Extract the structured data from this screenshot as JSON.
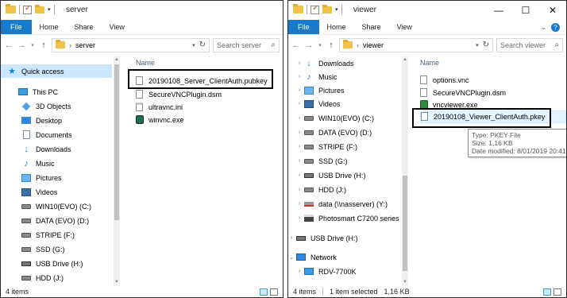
{
  "left_window": {
    "title": "server",
    "ribbon_tabs": [
      "File",
      "Home",
      "Share",
      "View"
    ],
    "address": "server",
    "search_placeholder": "Search server",
    "column_name": "Name",
    "files": [
      {
        "name": "20190108_Server_ClientAuth.pubkey",
        "icon": "file-icon"
      },
      {
        "name": "SecureVNCPlugin.dsm",
        "icon": "file-icon"
      },
      {
        "name": "ultravnc.ini",
        "icon": "ini-file-icon"
      },
      {
        "name": "winvnc.exe",
        "icon": "winvnc-exe-icon"
      }
    ],
    "nav_items": [
      {
        "label": "Quick access",
        "icon": "star-icon"
      },
      {
        "label": "This PC",
        "icon": "computer-icon"
      },
      {
        "label": "3D Objects",
        "icon": "3d-objects-icon"
      },
      {
        "label": "Desktop",
        "icon": "desktop-icon"
      },
      {
        "label": "Documents",
        "icon": "documents-icon"
      },
      {
        "label": "Downloads",
        "icon": "download-icon"
      },
      {
        "label": "Music",
        "icon": "music-icon"
      },
      {
        "label": "Pictures",
        "icon": "pictures-icon"
      },
      {
        "label": "Videos",
        "icon": "videos-icon"
      },
      {
        "label": "WIN10(EVO) (C:)",
        "icon": "drive-icon"
      },
      {
        "label": "DATA (EVO) (D:)",
        "icon": "drive-icon"
      },
      {
        "label": "STRIPE (F:)",
        "icon": "drive-icon"
      },
      {
        "label": "SSD (G:)",
        "icon": "drive-icon"
      },
      {
        "label": "USB Drive (H:)",
        "icon": "usb-drive-icon"
      },
      {
        "label": "HDD (J:)",
        "icon": "drive-icon"
      }
    ],
    "status": "4 items"
  },
  "right_window": {
    "title": "viewer",
    "ribbon_tabs": [
      "File",
      "Home",
      "Share",
      "View"
    ],
    "address": "viewer",
    "search_placeholder": "Search viewer",
    "column_name": "Name",
    "files": [
      {
        "name": "options.vnc",
        "icon": "file-icon"
      },
      {
        "name": "SecureVNCPlugin.dsm",
        "icon": "file-icon"
      },
      {
        "name": "vncviewer.exe",
        "icon": "vncviewer-exe-icon"
      },
      {
        "name": "20190108_Viewer_ClientAuth.pkey",
        "icon": "file-icon"
      }
    ],
    "nav_items": [
      {
        "label": "Downloads",
        "icon": "download-icon"
      },
      {
        "label": "Music",
        "icon": "music-icon"
      },
      {
        "label": "Pictures",
        "icon": "pictures-icon"
      },
      {
        "label": "Videos",
        "icon": "videos-icon"
      },
      {
        "label": "WIN10(EVO) (C:)",
        "icon": "drive-icon"
      },
      {
        "label": "DATA (EVO) (D:)",
        "icon": "drive-icon"
      },
      {
        "label": "STRIPE (F:)",
        "icon": "drive-icon"
      },
      {
        "label": "SSD (G:)",
        "icon": "drive-icon"
      },
      {
        "label": "USB Drive (H:)",
        "icon": "usb-drive-icon"
      },
      {
        "label": "HDD (J:)",
        "icon": "drive-icon"
      },
      {
        "label": "data (\\\\nasserver) (Y:)",
        "icon": "network-drive-icon"
      },
      {
        "label": "Photosmart C7200 series",
        "icon": "printer-icon"
      },
      {
        "label": "USB Drive (H:)",
        "icon": "usb-drive-icon"
      },
      {
        "label": "Network",
        "icon": "network-icon"
      },
      {
        "label": "RDV-7700K",
        "icon": "computer-icon"
      }
    ],
    "tooltip": {
      "type": "Type: PKEY File",
      "size": "Size: 1,16 KB",
      "modified": "Date modified: 8/01/2019 20:41"
    },
    "status": "4 items",
    "status_selected": "1 item selected",
    "status_size": "1,16 KB"
  },
  "colors": {
    "file_tab": "#1979ca",
    "selection": "#cce8ff",
    "highlight": "#e5f3ff"
  }
}
